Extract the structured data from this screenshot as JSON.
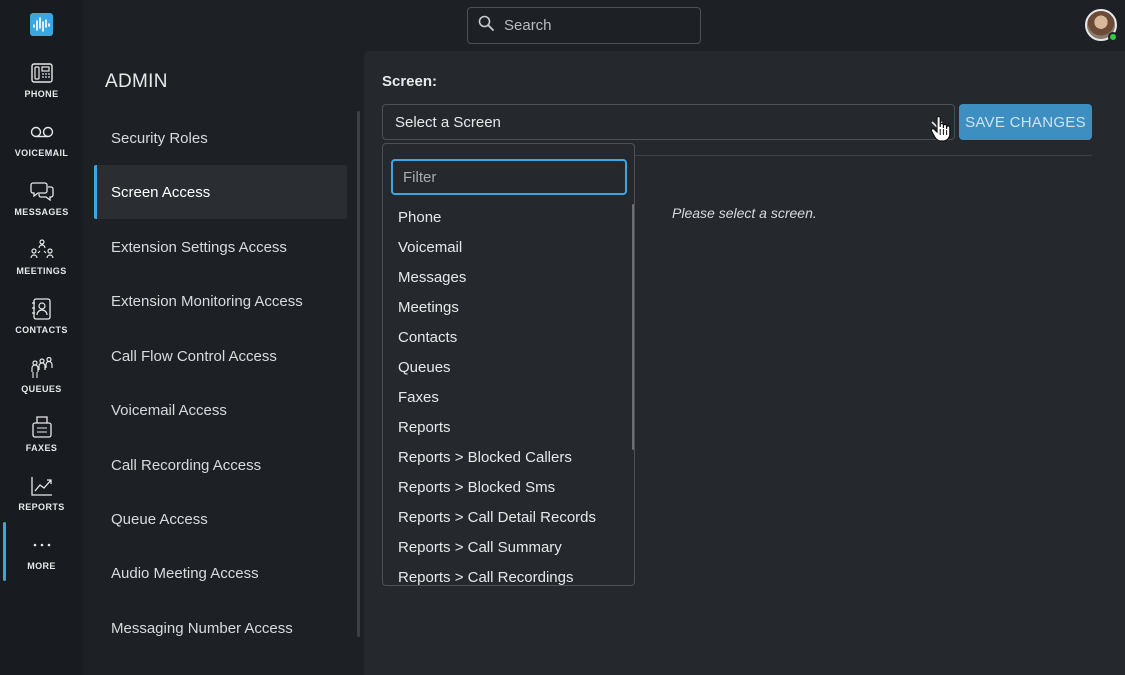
{
  "nav": {
    "items": [
      {
        "label": "PHONE",
        "icon": "phone-icon"
      },
      {
        "label": "VOICEMAIL",
        "icon": "voicemail-icon"
      },
      {
        "label": "MESSAGES",
        "icon": "messages-icon"
      },
      {
        "label": "MEETINGS",
        "icon": "meetings-icon"
      },
      {
        "label": "CONTACTS",
        "icon": "contacts-icon"
      },
      {
        "label": "QUEUES",
        "icon": "queues-icon"
      },
      {
        "label": "FAXES",
        "icon": "faxes-icon"
      },
      {
        "label": "REPORTS",
        "icon": "reports-icon"
      },
      {
        "label": "MORE",
        "icon": "more-icon"
      }
    ],
    "active": "MORE"
  },
  "search": {
    "placeholder": "Search"
  },
  "admin": {
    "title": "ADMIN",
    "items": [
      "Security Roles",
      "Screen Access",
      "Extension Settings Access",
      "Extension Monitoring Access",
      "Call Flow Control Access",
      "Voicemail Access",
      "Call Recording Access",
      "Queue Access",
      "Audio Meeting Access",
      "Messaging Number Access"
    ],
    "active": "Screen Access"
  },
  "main": {
    "screen_label": "Screen:",
    "select_value": "Select a Screen",
    "save_label": "SAVE CHANGES",
    "empty_message": "Please select a screen."
  },
  "dropdown": {
    "filter_placeholder": "Filter",
    "options": [
      "Phone",
      "Voicemail",
      "Messages",
      "Meetings",
      "Contacts",
      "Queues",
      "Faxes",
      "Reports",
      "Reports > Blocked Callers",
      "Reports > Blocked Sms",
      "Reports > Call Detail Records",
      "Reports > Call Summary",
      "Reports > Call Recordings"
    ]
  },
  "colors": {
    "accent": "#3aa7e0",
    "button": "#3d8fc2",
    "rail_bg": "#181b1f",
    "panel_bg": "#25292e",
    "presence": "#2ecc40"
  }
}
